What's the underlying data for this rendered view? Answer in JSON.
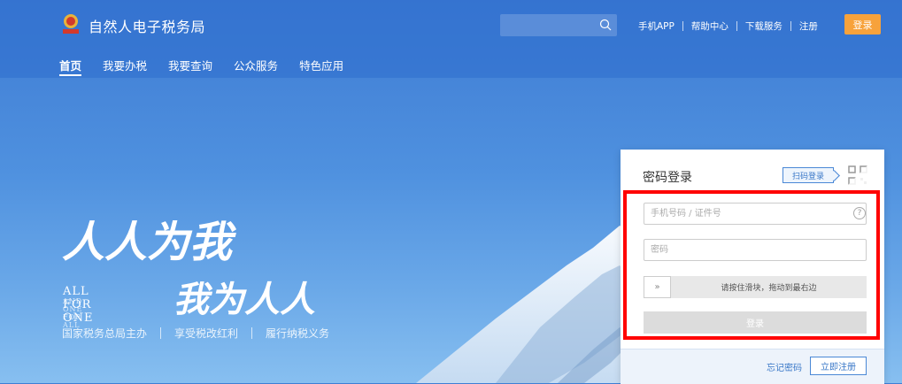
{
  "header": {
    "site_title": "自然人电子税务局",
    "search": {
      "placeholder": "",
      "icon": "search-icon"
    },
    "links": [
      "手机APP",
      "帮助中心",
      "下载服务",
      "注册"
    ],
    "login_label": "登录",
    "nav": [
      "首页",
      "我要办税",
      "我要查询",
      "公众服务",
      "特色应用"
    ],
    "nav_active": "首页"
  },
  "banner": {
    "slogan_cn_line1": "人人为我",
    "slogan_cn_line2": "我为人人",
    "slogan_en_line1": "ALL FOR ONE",
    "slogan_en_line2": "AND ONE FOR ALL",
    "tagline": [
      "国家税务总局主办",
      "享受税改红利",
      "履行纳税义务"
    ]
  },
  "login_panel": {
    "title": "密码登录",
    "scan_label": "扫码登录",
    "account_placeholder": "手机号码 / 证件号",
    "help_icon_text": "?",
    "password_placeholder": "密码",
    "slider_handle": "»",
    "slider_text": "请按住滑块，拖动到最右边",
    "submit_label": "登录",
    "forgot_label": "忘记密码",
    "register_label": "立即注册"
  },
  "colors": {
    "header_bg": "#2d6ecd",
    "login_btn": "#f7a23b",
    "accent": "#3a78c8",
    "highlight": "#ff0000"
  }
}
